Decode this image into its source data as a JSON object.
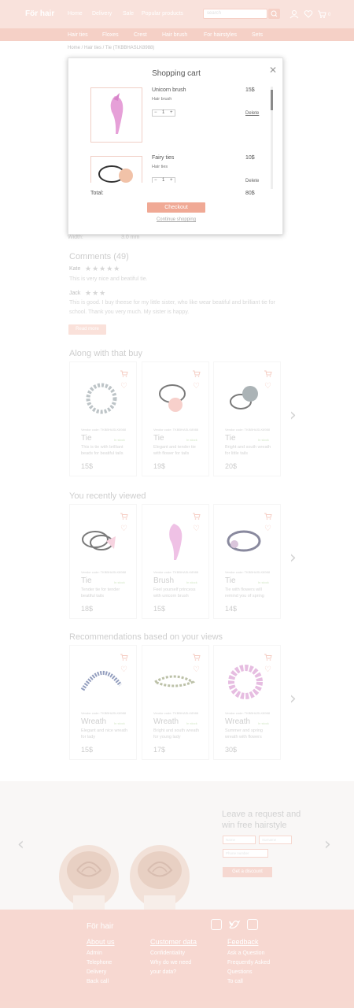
{
  "header": {
    "logo": "För hair",
    "nav": [
      "Home",
      "Delivery",
      "Sale",
      "Popular products"
    ],
    "search_placeholder": "search",
    "cart_count": "0"
  },
  "subnav": [
    "Hair ties",
    "Floxes",
    "Crest",
    "Hair brush",
    "For hairstyles",
    "Sets"
  ],
  "breadcrumb": "Home / Hair ties / Tie (TKBBHASLK8988)",
  "product": {
    "width_label": "Width:",
    "width_value": "3.0 mm"
  },
  "comments": {
    "title": "Comments (49)",
    "items": [
      {
        "name": "Kate",
        "stars": "★★★★★",
        "text": "This is very nice and beatiful tie."
      },
      {
        "name": "Jack",
        "stars": "★★★",
        "text": "This is good. I buy theese for my little sister, who like wear beatiful and brilliant tie for school. Thank you very much. My sister is happy."
      }
    ],
    "read_more": "Read more"
  },
  "sections": [
    {
      "title": "Along with that buy",
      "cards": [
        {
          "vendor": "Vendor code: TKBBHASLK8988",
          "name": "Tie",
          "stock": "In stock",
          "desc": "This is tie with brilliant beads for beatiful tails",
          "price": "15$",
          "img": "tie-beads"
        },
        {
          "vendor": "Vendor code: TKBBHASLK8988",
          "name": "Tie",
          "stock": "In stock",
          "desc": "Elegant and tender tie with flower for tails",
          "price": "19$",
          "img": "tie-flower"
        },
        {
          "vendor": "Vendor code: TKBBHASLK8988",
          "name": "Tie",
          "stock": "In stock",
          "desc": "Bright and south wreath for little tails",
          "price": "20$",
          "img": "tie-pom"
        }
      ]
    },
    {
      "title": "You recently viewed",
      "cards": [
        {
          "vendor": "Vendor code: TKBBHASLK8988",
          "name": "Tie",
          "stock": "In stock",
          "desc": "Tender tie for tender beatiful tails",
          "price": "18$",
          "img": "tie-bow"
        },
        {
          "vendor": "Vendor code: TKBBHASLK8988",
          "name": "Brush",
          "stock": "In stock",
          "desc": "Feel yourself princess with unicorn brush",
          "price": "15$",
          "img": "brush"
        },
        {
          "vendor": "Vendor code: TKBBHASLK8988",
          "name": "Tie",
          "stock": "In stock",
          "desc": "Tie with flowers will remind you of spring",
          "price": "14$",
          "img": "tie-flowers"
        }
      ]
    },
    {
      "title": "Recommendations based on your views",
      "cards": [
        {
          "vendor": "Vendor code: TKBBHASLK8988",
          "name": "Wreath",
          "stock": "In stock",
          "desc": "Elegant and nice wreath for lady",
          "price": "15$",
          "img": "wreath-blue"
        },
        {
          "vendor": "Vendor code: TKBBHASLK8988",
          "name": "Wreath",
          "stock": "In stock",
          "desc": "Bright and south wreath for young lady",
          "price": "17$",
          "img": "wreath-green"
        },
        {
          "vendor": "Vendor code: TKBBHASLK8988",
          "name": "Wreath",
          "stock": "In stock",
          "desc": "Summer and spring wreath with flowers",
          "price": "30$",
          "img": "wreath-pink"
        }
      ]
    }
  ],
  "banner": {
    "title": "Leave a request and win free hairstyle",
    "name_placeholder": "Name",
    "surname_placeholder": "Surname",
    "phone_placeholder": "Phone number",
    "button": "Get a discount"
  },
  "footer": {
    "logo": "För hair",
    "cols": [
      {
        "head": "About us",
        "links": [
          "Admin",
          "Telephone",
          "Delivery",
          "Back call"
        ]
      },
      {
        "head": "Customer data",
        "links": [
          "Confidentiality",
          "Why do we need",
          "your data?"
        ]
      },
      {
        "head": "Feedback",
        "links": [
          "Ask a Question",
          "Frequently Asked",
          "Questions",
          "To call"
        ]
      }
    ]
  },
  "cart": {
    "title": "Shopping cart",
    "items": [
      {
        "name": "Unicorn brush",
        "category": "Hair brush",
        "price": "15$",
        "qty": "1",
        "delete": "Delete",
        "img": "brush"
      },
      {
        "name": "Fairy ties",
        "category": "Hair ties",
        "price": "10$",
        "qty": "1",
        "delete": "Delete",
        "img": "tie-bow"
      }
    ],
    "total_label": "Total:",
    "total_value": "80$",
    "checkout": "Checkout",
    "continue": "Continue shopping"
  },
  "colors": {
    "accent": "#f0b7a8",
    "header": "#f6d3c9",
    "footer": "#f3c4b8",
    "checkout": "#f0a995"
  }
}
